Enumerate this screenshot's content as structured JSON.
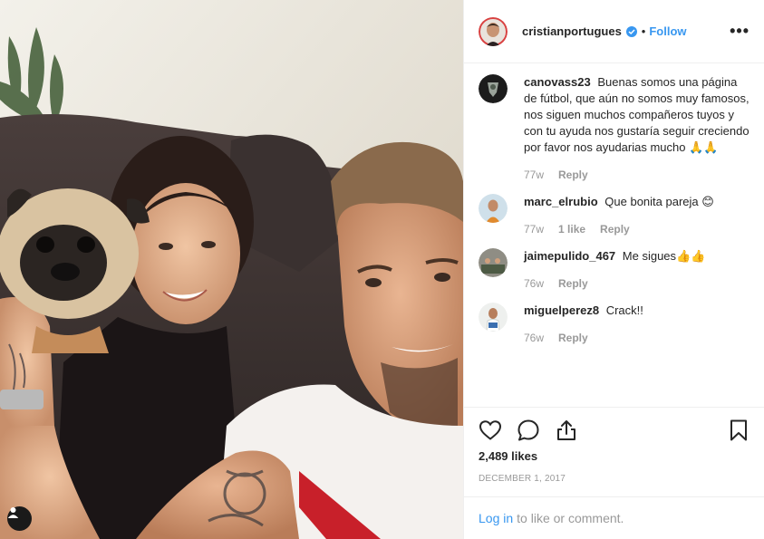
{
  "header": {
    "username": "cristianportugues",
    "separator": "•",
    "follow_label": "Follow",
    "more_label": "•••",
    "avatar_icon": "profile-avatar",
    "verified_icon": "verified-badge-icon",
    "accent": "#3897f0"
  },
  "comments": [
    {
      "username": "canovass23",
      "text": "Buenas somos una página de fútbol, que aún no somos muy famosos, nos siguen muchos compañeros tuyos y con tu ayuda nos gustaría seguir creciendo por favor nos ayudarias mucho 🙏🙏",
      "time": "77w",
      "likes": "",
      "reply": "Reply"
    },
    {
      "username": "marc_elrubio",
      "text": "Que bonita pareja 😊",
      "time": "77w",
      "likes": "1 like",
      "reply": "Reply"
    },
    {
      "username": "jaimepulido_467",
      "text": "Me sigues👍👍",
      "time": "76w",
      "likes": "",
      "reply": "Reply"
    },
    {
      "username": "miguelperez8",
      "text": "Crack!!",
      "time": "76w",
      "likes": "",
      "reply": "Reply"
    }
  ],
  "actions": {
    "like_icon": "heart-icon",
    "comment_icon": "comment-icon",
    "share_icon": "share-icon",
    "save_icon": "bookmark-icon"
  },
  "likes_count": "2,489 likes",
  "date": "DECEMBER 1, 2017",
  "login": {
    "link_label": "Log in",
    "suffix": "to like or comment."
  },
  "photo": {
    "user_tag_icon": "user-tag-icon"
  }
}
